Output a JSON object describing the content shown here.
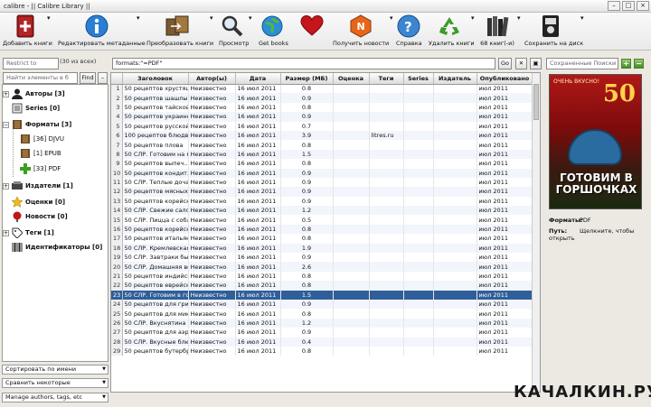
{
  "window": {
    "title": "calibre - || Calibre Library ||"
  },
  "toolbar": {
    "add": "Добавить книги",
    "edit": "Редактировать метаданные",
    "convert": "Преобразовать книги",
    "view": "Просмотр",
    "get": "Get books",
    "news": "Получить новости",
    "help": "Справка",
    "remove": "Удалить книги",
    "library": "68 книг(-и)",
    "save": "Сохранить на диск"
  },
  "search": {
    "restrict": "Restrict to",
    "count": "(30 из всех)",
    "query": "formats:\"=PDF\"",
    "go": "Go",
    "saved": "Сохраненные Поиски",
    "find_placeholder": "Найти элементы в б",
    "find": "Find"
  },
  "tree": {
    "authors": "Авторы [3]",
    "series": "Series [0]",
    "formats": "Форматы [3]",
    "djvu": "[36] DJVU",
    "epub": "[1] EPUB",
    "pdf": "[33] PDF",
    "publishers": "Издатели [1]",
    "ratings": "Оценки [0]",
    "news": "Новости [0]",
    "tags": "Теги [1]",
    "identifiers": "Идентификаторы [0]"
  },
  "left_bottom": {
    "sort": "Сортировать по имени",
    "match": "Сравнить некоторые",
    "manage": "Manage authors, tags, etc"
  },
  "table": {
    "columns": [
      "",
      "Заголовок",
      "Автор(ы)",
      "Дата",
      "Размер (МБ)",
      "Оценка",
      "Теги",
      "Series",
      "Издатель",
      "Опубликовано"
    ],
    "rows": [
      [
        "1",
        "50 рецептов хрустящ...",
        "Неизвестно",
        "16 июл 2011",
        "0.8",
        "",
        "",
        "",
        "",
        "июл 2011"
      ],
      [
        "2",
        "50 рецептов шашлык...",
        "Неизвестно",
        "16 июл 2011",
        "0.9",
        "",
        "",
        "",
        "",
        "июл 2011"
      ],
      [
        "3",
        "50 рецептов тайской...",
        "Неизвестно",
        "16 июл 2011",
        "0.8",
        "",
        "",
        "",
        "",
        "июл 2011"
      ],
      [
        "4",
        "50 рецептов украинс...",
        "Неизвестно",
        "16 июл 2011",
        "0.9",
        "",
        "",
        "",
        "",
        "июл 2011"
      ],
      [
        "5",
        "50 рецептов русской...",
        "Неизвестно",
        "16 июл 2011",
        "0.7",
        "",
        "",
        "",
        "",
        "июл 2011"
      ],
      [
        "6",
        "100 рецептов блюдв",
        "Неизвестно",
        "16 июл 2011",
        "3.9",
        "",
        "litres.ru",
        "",
        "",
        "июл 2011"
      ],
      [
        "7",
        "50 рецептов плова",
        "Неизвестно",
        "16 июл 2011",
        "0.8",
        "",
        "",
        "",
        "",
        "июл 2011"
      ],
      [
        "8",
        "50 СЛР. Готовим на м...",
        "Неизвестно",
        "16 июл 2011",
        "1.5",
        "",
        "",
        "",
        "",
        "июл 2011"
      ],
      [
        "9",
        "50 рецептов выпеч...",
        "Неизвестно",
        "16 июл 2011",
        "0.8",
        "",
        "",
        "",
        "",
        "июл 2011"
      ],
      [
        "10",
        "50 рецептов кондит...",
        "Неизвестно",
        "16 июл 2011",
        "0.9",
        "",
        "",
        "",
        "",
        "июл 2011"
      ],
      [
        "11",
        "50 СЛР. Теплые доча...",
        "Неизвестно",
        "16 июл 2011",
        "0.9",
        "",
        "",
        "",
        "",
        "июл 2011"
      ],
      [
        "12",
        "50 рецептов мясных ...",
        "Неизвестно",
        "16 июл 2011",
        "0.9",
        "",
        "",
        "",
        "",
        "июл 2011"
      ],
      [
        "13",
        "50 рецептов корейск...",
        "Неизвестно",
        "16 июл 2011",
        "0.9",
        "",
        "",
        "",
        "",
        "июл 2011"
      ],
      [
        "14",
        "50 СЛР. Свежие сало...",
        "Неизвестно",
        "16 июл 2011",
        "1.2",
        "",
        "",
        "",
        "",
        "июл 2011"
      ],
      [
        "15",
        "50 СЛР. Пицца с собл...",
        "Неизвестно",
        "16 июл 2011",
        "0.5",
        "",
        "",
        "",
        "",
        "июл 2011"
      ],
      [
        "16",
        "50 рецептов корейск...",
        "Неизвестно",
        "16 июл 2011",
        "0.8",
        "",
        "",
        "",
        "",
        "июл 2011"
      ],
      [
        "17",
        "50 рецептов итальян...",
        "Неизвестно",
        "16 июл 2011",
        "0.8",
        "",
        "",
        "",
        "",
        "июл 2011"
      ],
      [
        "18",
        "50 СЛР. Кремлевская...",
        "Неизвестно",
        "16 июл 2011",
        "1.9",
        "",
        "",
        "",
        "",
        "июл 2011"
      ],
      [
        "19",
        "50 СЛР. Завтраки бы...",
        "Неизвестно",
        "16 июл 2011",
        "0.9",
        "",
        "",
        "",
        "",
        "июл 2011"
      ],
      [
        "20",
        "50 СЛР. Домашняя во...",
        "Неизвестно",
        "16 июл 2011",
        "2.6",
        "",
        "",
        "",
        "",
        "июл 2011"
      ],
      [
        "21",
        "50 рецептов индийск...",
        "Неизвестно",
        "16 июл 2011",
        "0.8",
        "",
        "",
        "",
        "",
        "июл 2011"
      ],
      [
        "22",
        "50 рецептов еврейск...",
        "Неизвестно",
        "16 июл 2011",
        "0.8",
        "",
        "",
        "",
        "",
        "июл 2011"
      ],
      [
        "23",
        "50 СЛР. Готовим в го...",
        "Неизвестно",
        "16 июл 2011",
        "1.5",
        "",
        "",
        "",
        "",
        "июл 2011"
      ],
      [
        "24",
        "50 рецептов для гриля",
        "Неизвестно",
        "16 июл 2011",
        "0.9",
        "",
        "",
        "",
        "",
        "июл 2011"
      ],
      [
        "25",
        "50 рецептов для микр...",
        "Неизвестно",
        "16 июл 2011",
        "0.8",
        "",
        "",
        "",
        "",
        "июл 2011"
      ],
      [
        "26",
        "50 СЛР. Вкуснятина ...",
        "Неизвестно",
        "16 июл 2011",
        "1.2",
        "",
        "",
        "",
        "",
        "июл 2011"
      ],
      [
        "27",
        "50 рецептов для аэр...",
        "Неизвестно",
        "16 июл 2011",
        "0.9",
        "",
        "",
        "",
        "",
        "июл 2011"
      ],
      [
        "28",
        "50 СЛР. Вкусные блю...",
        "Неизвестно",
        "16 июл 2011",
        "0.4",
        "",
        "",
        "",
        "",
        "июл 2011"
      ],
      [
        "29",
        "50 рецептов бутербр...",
        "Неизвестно",
        "16 июл 2011",
        "0.8",
        "",
        "",
        "",
        "",
        "июл 2011"
      ]
    ],
    "selected_row": 22
  },
  "book": {
    "cover_top": "ОЧЕНЬ ВКУСНО!",
    "cover_num": "50",
    "cover_title": "ГОТОВИМ В ГОРШОЧКАХ",
    "formats_label": "Форматы:",
    "formats_value": "PDF",
    "path_label": "Путь:",
    "path_value": "Щелкните, чтобы открыть"
  },
  "watermark": "КАЧАЛКИН.РУ"
}
